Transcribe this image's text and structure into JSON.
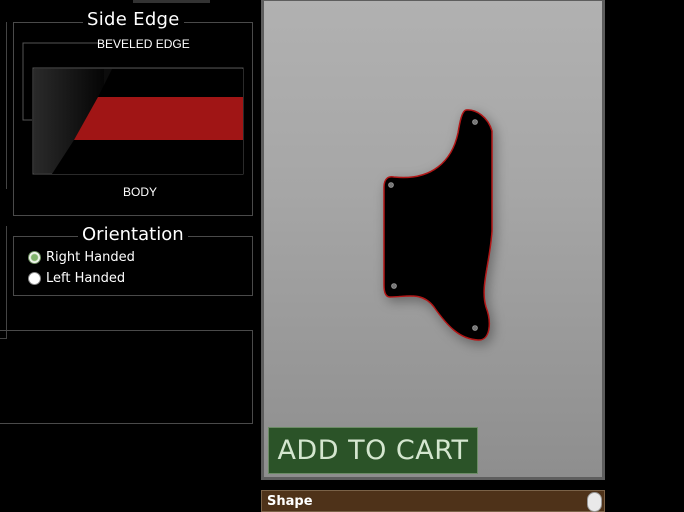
{
  "side_edge": {
    "title": "Side Edge",
    "top_label": "BEVELED EDGE",
    "bottom_label": "BODY",
    "colors": {
      "band": "#a01515",
      "body": "#000000"
    }
  },
  "orientation": {
    "title": "Orientation",
    "options": [
      {
        "label": "Right Handed",
        "selected": true
      },
      {
        "label": "Left Handed",
        "selected": false
      }
    ]
  },
  "preview": {
    "pickguard_color": "#000000",
    "edge_color": "#b01818",
    "screw_icon": "screw-hole-icon"
  },
  "add_to_cart": {
    "label": "ADD TO CART"
  },
  "shape_panel": {
    "label": "Shape"
  }
}
